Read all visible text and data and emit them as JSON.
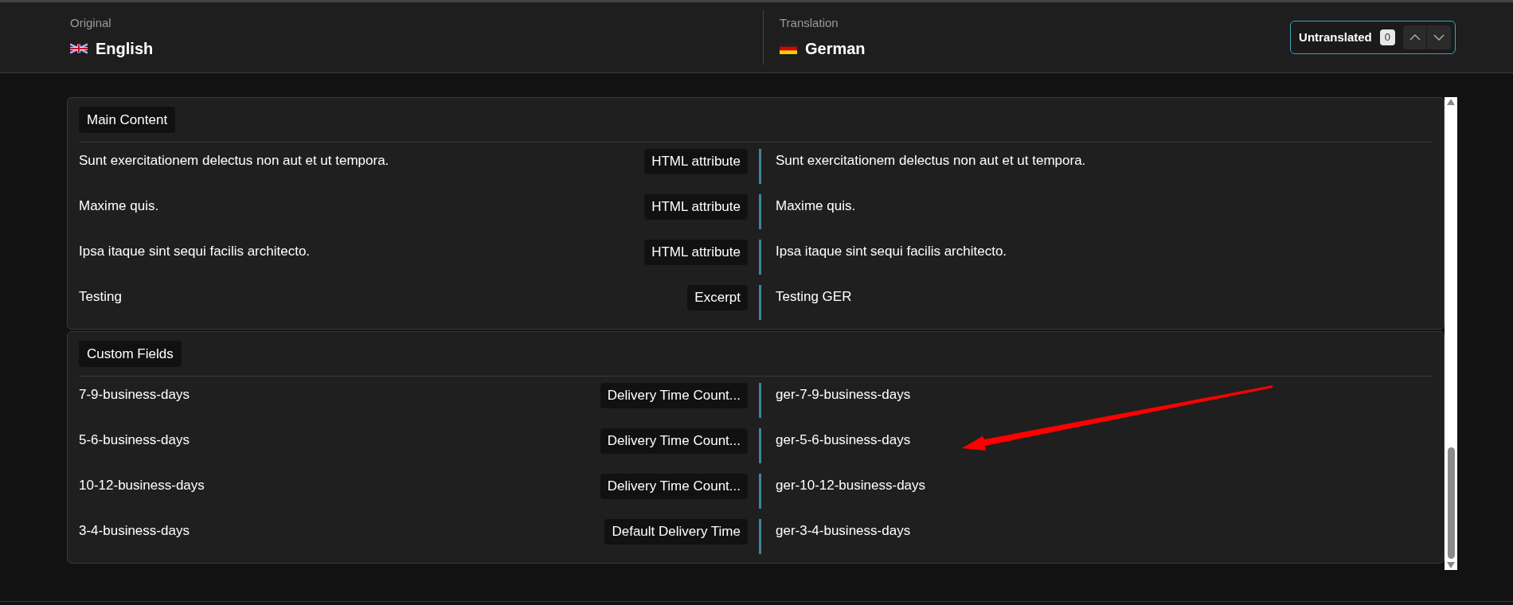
{
  "header": {
    "original": {
      "label": "Original",
      "language": "English"
    },
    "translation": {
      "label": "Translation",
      "language": "German"
    },
    "filter": {
      "label": "Untranslated",
      "count": "0"
    }
  },
  "sections": [
    {
      "title": "Main Content",
      "rows": [
        {
          "original": "Sunt exercitationem delectus non aut et ut tempora.",
          "type": "HTML attribute",
          "translation": "Sunt exercitationem delectus non aut et ut tempora."
        },
        {
          "original": "Maxime quis.",
          "type": "HTML attribute",
          "translation": "Maxime quis."
        },
        {
          "original": "Ipsa itaque sint sequi facilis architecto.",
          "type": "HTML attribute",
          "translation": "Ipsa itaque sint sequi facilis architecto."
        },
        {
          "original": "Testing",
          "type": "Excerpt",
          "translation": "Testing GER"
        }
      ]
    },
    {
      "title": "Custom Fields",
      "rows": [
        {
          "original": "7-9-business-days",
          "type": "Delivery Time Count...",
          "translation": "ger-7-9-business-days"
        },
        {
          "original": "5-6-business-days",
          "type": "Delivery Time Count...",
          "translation": "ger-5-6-business-days"
        },
        {
          "original": "10-12-business-days",
          "type": "Delivery Time Count...",
          "translation": "ger-10-12-business-days"
        },
        {
          "original": "3-4-business-days",
          "type": "Default Delivery Time",
          "translation": "ger-3-4-business-days"
        }
      ]
    }
  ]
}
